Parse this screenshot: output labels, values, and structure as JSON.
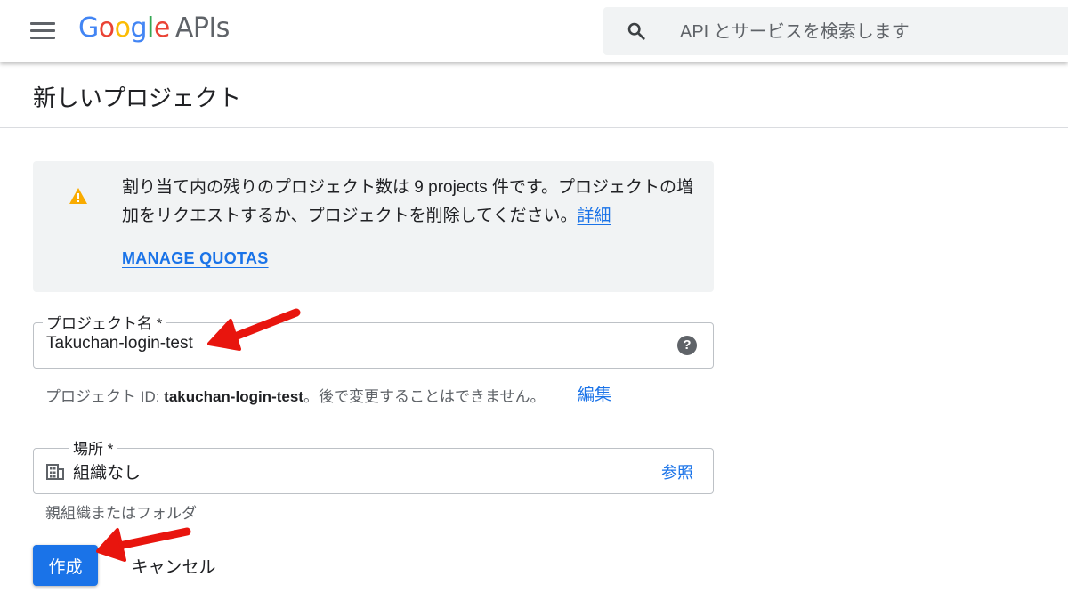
{
  "header": {
    "logo": {
      "letters": [
        {
          "char": "G",
          "color": "#4285F4"
        },
        {
          "char": "o",
          "color": "#EA4335"
        },
        {
          "char": "o",
          "color": "#FBBC05"
        },
        {
          "char": "g",
          "color": "#4285F4"
        },
        {
          "char": "l",
          "color": "#34A853"
        },
        {
          "char": "e",
          "color": "#EA4335"
        }
      ],
      "suffix": "APIs"
    },
    "search": {
      "placeholder": "API とサービスを検索します",
      "icon": "search-icon"
    },
    "menu_icon": "hamburger-menu-icon"
  },
  "page": {
    "title": "新しいプロジェクト"
  },
  "alert": {
    "icon": "warning-icon",
    "text": "割り当て内の残りのプロジェクト数は 9 projects 件です。プロジェクトの増加をリクエストするか、プロジェクトを削除してください。",
    "details_link": "詳細",
    "manage_quotas": "MANAGE QUOTAS"
  },
  "form": {
    "project_name": {
      "label": "プロジェクト名 *",
      "value": "Takuchan-login-test",
      "help_icon": "help-icon"
    },
    "project_id_hint": {
      "prefix": "プロジェクト ID: ",
      "id": "takuchan-login-test",
      "suffix": "。後で変更することはできません。",
      "edit_link": "編集"
    },
    "location": {
      "label": "場所 *",
      "value": "組織なし",
      "browse": "参照",
      "icon": "organization-icon",
      "hint": "親組織またはフォルダ"
    }
  },
  "actions": {
    "create": "作成",
    "cancel": "キャンセル"
  },
  "colors": {
    "accent": "#1a73e8",
    "warning": "#f9ab00",
    "annotation_arrow": "#e8150e"
  }
}
